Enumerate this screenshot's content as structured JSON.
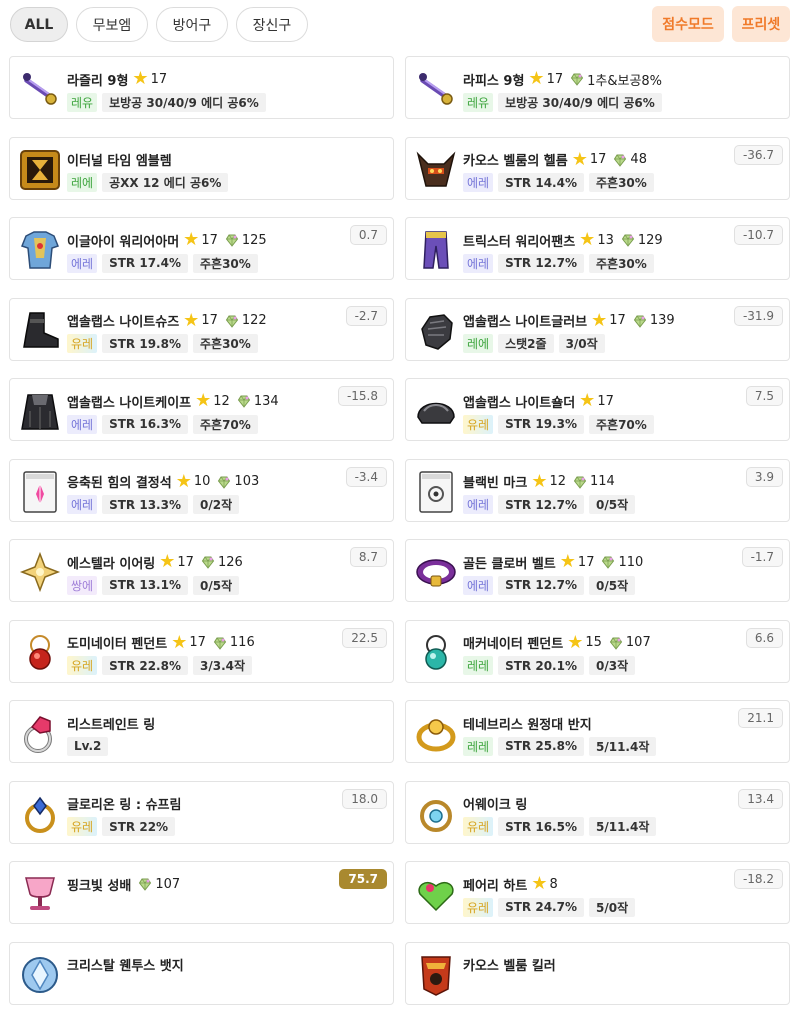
{
  "tabs": [
    {
      "label": "ALL",
      "active": true
    },
    {
      "label": "무보엠",
      "active": false
    },
    {
      "label": "방어구",
      "active": false
    },
    {
      "label": "장신구",
      "active": false
    }
  ],
  "actions": {
    "score_mode": "점수모드",
    "preset": "프리셋"
  },
  "colors": {
    "accent_orange": "#f07a2a",
    "accent_bg": "#fde6d5",
    "high_score": "#a9892f",
    "star": "#f5c416"
  },
  "items": [
    {
      "name": "라즐리 9형",
      "icon": "lapis-staff-icon",
      "star": "17",
      "flame": "",
      "pot_label": "레유",
      "chips": [
        "보방공 30/40/9 에디 공6%"
      ],
      "score": ""
    },
    {
      "name": "라피스 9형",
      "icon": "lapis-staff-icon",
      "star": "17",
      "flame": "1추&보공8%",
      "pot_label": "레유",
      "chips": [
        "보방공 30/40/9 에디 공6%"
      ],
      "score": ""
    },
    {
      "name": "이터널 타임 엠블렘",
      "icon": "emblem-icon",
      "star": "",
      "flame": "",
      "pot_label": "레에",
      "chips": [
        "공XX 12 에디 공6%"
      ],
      "score": ""
    },
    {
      "name": "카오스 벨룸의 헬름",
      "icon": "helm-icon",
      "star": "17",
      "flame": "48",
      "pot_label": "에레",
      "chips": [
        "STR 14.4%",
        "주흔30%"
      ],
      "score": "-36.7"
    },
    {
      "name": "이글아이 워리어아머",
      "icon": "armor-icon",
      "star": "17",
      "flame": "125",
      "pot_label": "에레",
      "chips": [
        "STR 17.4%",
        "주흔30%"
      ],
      "score": "0.7"
    },
    {
      "name": "트릭스터 워리어팬츠",
      "icon": "pants-icon",
      "star": "13",
      "flame": "129",
      "pot_label": "에레",
      "chips": [
        "STR 12.7%",
        "주흔30%"
      ],
      "score": "-10.7"
    },
    {
      "name": "앱솔랩스 나이트슈즈",
      "icon": "shoes-icon",
      "star": "17",
      "flame": "122",
      "pot_label": "유레",
      "chips": [
        "STR 19.8%",
        "주흔30%"
      ],
      "score": "-2.7"
    },
    {
      "name": "앱솔랩스 나이트글러브",
      "icon": "glove-icon",
      "star": "17",
      "flame": "139",
      "pot_label": "레에",
      "chips": [
        "스탯2줄",
        "3/0작"
      ],
      "score": "-31.9"
    },
    {
      "name": "앱솔랩스 나이트케이프",
      "icon": "cape-icon",
      "star": "12",
      "flame": "134",
      "pot_label": "에레",
      "chips": [
        "STR 16.3%",
        "주흔70%"
      ],
      "score": "-15.8"
    },
    {
      "name": "앱솔랩스 나이트숄더",
      "icon": "shoulder-icon",
      "star": "17",
      "flame": "",
      "pot_label": "유레",
      "chips": [
        "STR 19.3%",
        "주흔70%"
      ],
      "score": "7.5"
    },
    {
      "name": "응축된 힘의 결정석",
      "icon": "crystal-badge-icon",
      "star": "10",
      "flame": "103",
      "pot_label": "에레",
      "chips": [
        "STR 13.3%",
        "0/2작"
      ],
      "score": "-3.4"
    },
    {
      "name": "블랙빈 마크",
      "icon": "blackbean-mark-icon",
      "star": "12",
      "flame": "114",
      "pot_label": "에레",
      "chips": [
        "STR 12.7%",
        "0/5작"
      ],
      "score": "3.9"
    },
    {
      "name": "에스텔라 이어링",
      "icon": "earring-icon",
      "star": "17",
      "flame": "126",
      "pot_label": "쌍에",
      "chips": [
        "STR 13.1%",
        "0/5작"
      ],
      "score": "8.7"
    },
    {
      "name": "골든 클로버 벨트",
      "icon": "belt-icon",
      "star": "17",
      "flame": "110",
      "pot_label": "에레",
      "chips": [
        "STR 12.7%",
        "0/5작"
      ],
      "score": "-1.7"
    },
    {
      "name": "도미네이터 펜던트",
      "icon": "pendant-red-icon",
      "star": "17",
      "flame": "116",
      "pot_label": "유레",
      "chips": [
        "STR 22.8%",
        "3/3.4작"
      ],
      "score": "22.5"
    },
    {
      "name": "매커네이터 펜던트",
      "icon": "pendant-teal-icon",
      "star": "15",
      "flame": "107",
      "pot_label": "레레",
      "chips": [
        "STR 20.1%",
        "0/3작"
      ],
      "score": "6.6"
    },
    {
      "name": "리스트레인트 링",
      "icon": "ring-red-icon",
      "star": "",
      "flame": "",
      "pot_label": "",
      "chips": [
        "Lv.2"
      ],
      "score": ""
    },
    {
      "name": "테네브리스 원정대 반지",
      "icon": "ring-gold-icon",
      "star": "",
      "flame": "",
      "pot_label": "레레",
      "chips": [
        "STR 25.8%",
        "5/11.4작"
      ],
      "score": "21.1"
    },
    {
      "name": "글로리온 링 : 슈프림",
      "icon": "ring-glorion-icon",
      "star": "",
      "flame": "",
      "pot_label": "유레",
      "chips": [
        "STR 22%"
      ],
      "score": "18.0"
    },
    {
      "name": "어웨이크 링",
      "icon": "ring-awake-icon",
      "star": "",
      "flame": "",
      "pot_label": "유레",
      "chips": [
        "STR 16.5%",
        "5/11.4작"
      ],
      "score": "13.4"
    },
    {
      "name": "핑크빛 성배",
      "icon": "pink-goblet-icon",
      "star": "",
      "flame": "107",
      "pot_label": "",
      "chips": [],
      "score": "75.7"
    },
    {
      "name": "페어리 하트",
      "icon": "fairy-heart-icon",
      "star": "8",
      "flame": "",
      "pot_label": "유레",
      "chips": [
        "STR 24.7%",
        "5/0작"
      ],
      "score": "-18.2"
    },
    {
      "name": "크리스탈 웬투스 뱃지",
      "icon": "crystal-badge-round-icon",
      "star": "",
      "flame": "",
      "pot_label": "",
      "chips": [],
      "score": ""
    },
    {
      "name": "카오스 벨룸 킬러",
      "icon": "chaos-killer-icon",
      "star": "",
      "flame": "",
      "pot_label": "",
      "chips": [],
      "score": ""
    }
  ]
}
